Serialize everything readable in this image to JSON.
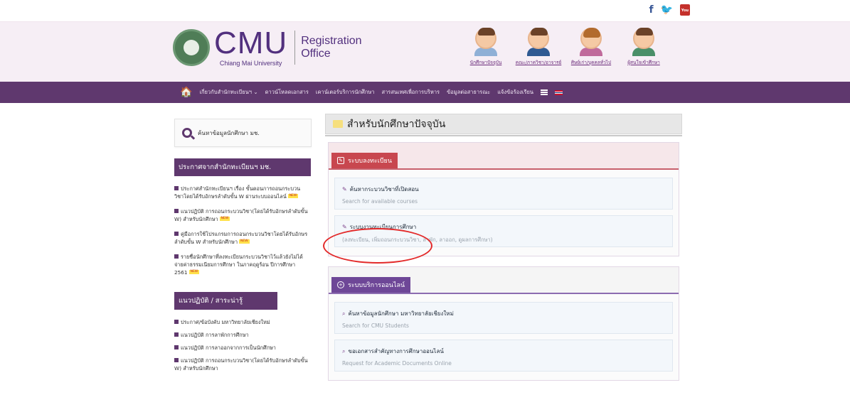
{
  "social": {
    "facebook": "f",
    "twitter": "🐦",
    "youtube_top": "You",
    "youtube_bottom": "Tube"
  },
  "logo": {
    "title": "CMU",
    "subtitle": "Chiang Mai University",
    "office_line1": "Registration",
    "office_line2": "Office"
  },
  "roles": [
    {
      "label": "นักศึกษาปัจจุบัน"
    },
    {
      "label": "คณะ/ภาควิชา/อาจารย์"
    },
    {
      "label": "ศิษย์เก่า/บุคคลทั่วไป"
    },
    {
      "label": "ผู้สนใจเข้าศึกษา"
    }
  ],
  "nav": {
    "items": [
      "เกี่ยวกับสำนักทะเบียนฯ ⌄",
      "ดาวน์โหลดเอกสาร",
      "เคาน์เตอร์บริการนักศึกษา",
      "สารสนเทศเพื่อการบริหาร",
      "ข้อมูลต่อสาธารณะ",
      "แจ้งข้อร้องเรียน"
    ]
  },
  "sidebar": {
    "search_label": "ค้นหาข้อมูลนักศึกษา มช.",
    "news_title": "ประกาศจากสำนักทะเบียนฯ มช.",
    "new_tag": "NEW",
    "news": [
      "ประกาศสำนักทะเบียนฯ เรื่อง ขั้นตอนการถอนกระบวนวิชาโดยได้รับอักษรลำดับขั้น W ผ่านระบบออนไลน์",
      "แนวปฏิบัติ การถอนกระบวนวิชา(โดยได้รับอักษรลำดับขั้น W) สำหรับนักศึกษา",
      "คู่มือการใช้โปรแกรมการถอนกระบวนวิชาโดยได้รับอักษรลำดับขั้น W สำหรับนักศึกษา",
      "รายชื่อนักศึกษาที่ลงทะเบียนกระบวนวิชาไว้แล้วยังไม่ได้จ่ายค่าธรรมเนียมการศึกษา ในภาคฤดูร้อน ปีการศึกษา 2561"
    ],
    "rules_title": "แนวปฏิบัติ / สาระน่ารู้",
    "rules": [
      "ประกาศ/ข้อบังคับ มหาวิทยาลัยเชียงใหม่",
      "แนวปฏิบัติ การลาพักการศึกษา",
      "แนวปฏิบัติ การลาออกจากการเป็นนักศึกษา",
      "แนวปฏิบัติ การถอนกระบวนวิชา(โดยได้รับอักษรลำดับขั้น W) สำหรับนักศึกษา"
    ]
  },
  "main": {
    "title": "สำหรับนักศึกษาปัจจุบัน",
    "registration": {
      "header": "ระบบลงทะเบียน",
      "cards": [
        {
          "title": "ค้นหากระบวนวิชาที่เปิดสอน",
          "subtitle": "Search for available courses"
        },
        {
          "title": "ระบบงานทะเบียนการศึกษา",
          "subtitle": "(ลงทะเบียน, เพิ่มถอนกระบวนวิชา, ลาพัก, ลาออก, ดูผลการศึกษา)"
        }
      ]
    },
    "online": {
      "header": "ระบบบริการออนไลน์",
      "cards": [
        {
          "title": "ค้นหาข้อมูลนักศึกษา มหาวิทยาลัยเชียงใหม่",
          "subtitle": "Search for CMU Students"
        },
        {
          "title": "ขอเอกสารสำคัญทางการศึกษาออนไลน์",
          "subtitle": "Request for Academic Documents Online"
        }
      ]
    }
  },
  "colors": {
    "brand_purple": "#5f386e",
    "accent_red": "#c8474f",
    "annotation_red": "#e32a2a"
  }
}
